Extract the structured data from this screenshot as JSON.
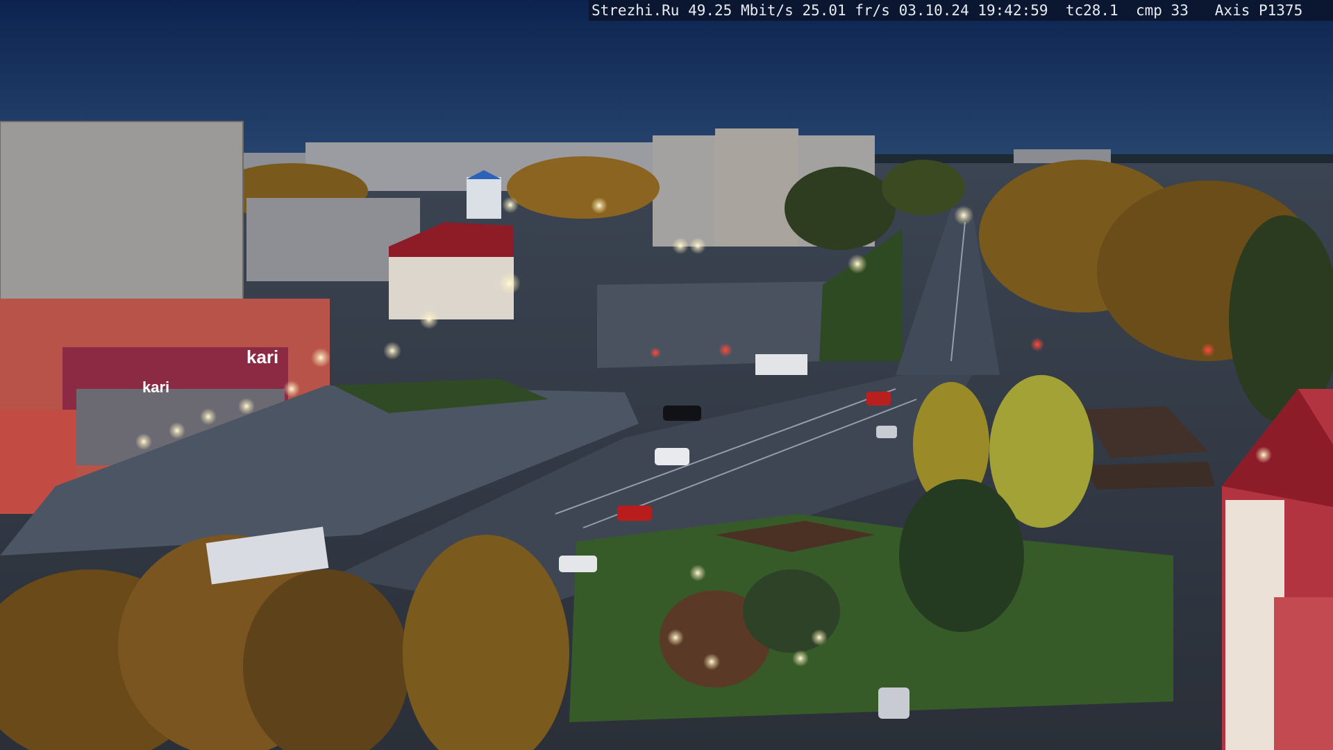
{
  "camera_overlay": {
    "site": "Strezhi.Ru",
    "bitrate": "49.25 Mbit/s",
    "framerate": "25.01 fr/s",
    "date": "03.10.24",
    "time": "19:42:59",
    "tc": "tc28.1",
    "cmp": "cmp 33",
    "camera_model": "Axis P1375"
  },
  "signage": {
    "store_sign_left": "kari",
    "store_sign_right": "kari"
  },
  "colors": {
    "sky_top": "#0c2350",
    "sky_horizon": "#23406b",
    "street_light": "#fff6d8",
    "foliage_autumn": "#8a6420",
    "kari_magenta": "#c0246a",
    "roof_red": "#a01c2a"
  }
}
